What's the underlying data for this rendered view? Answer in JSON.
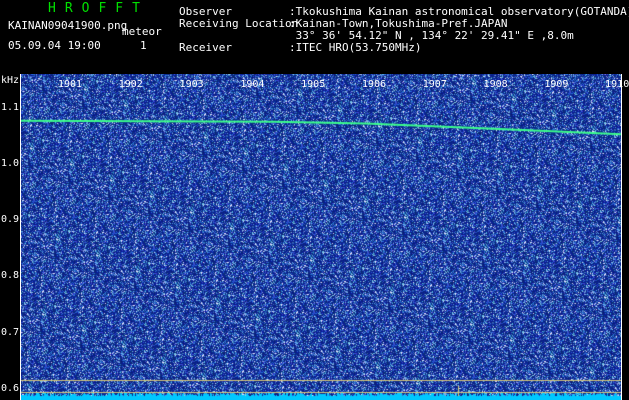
{
  "header": {
    "title": "HROFFT",
    "filename": "KAINAN09041900.png",
    "meteor_label": "meteor",
    "datetime": "05.09.04 19:00",
    "meteor_count": "1",
    "observer_label": "Observer",
    "observer_value": ":Tkokushima Kainan astronomical observatory(GOTANDA)",
    "location_label": "Receiving Location",
    "location_value": ":Kainan-Town,Tokushima-Pref.JAPAN",
    "coords_value": " 33° 36' 54.12\" N , 134° 22' 29.41\" E ,8.0m",
    "receiver_label": "Receiver",
    "receiver_value": ":ITEC HRO(53.750MHz)"
  },
  "colors": {
    "title": "#00e000",
    "header_text": "#ffffff",
    "background": "#000000",
    "noise_base": "#1a2a90",
    "trace": "#3cff8c",
    "floor": "#00c8ff",
    "marker": "#d8c878"
  },
  "chart_data": {
    "type": "heatmap",
    "y_unit": "kHz",
    "y_ticks": [
      "1.1",
      "1.0",
      "0.9",
      "0.8",
      "0.7",
      "0.6"
    ],
    "y_range": [
      0.58,
      1.16
    ],
    "x_ticks": [
      "1901",
      "1902",
      "1903",
      "1904",
      "1905",
      "1906",
      "1907",
      "1908",
      "1909",
      "1910"
    ],
    "trace": {
      "x": [
        "1900",
        "1904.5",
        "1906",
        "1908",
        "1910.2"
      ],
      "y": [
        1.077,
        1.075,
        1.072,
        1.063,
        1.053
      ]
    },
    "horizontal_lines_khz": [
      0.615,
      0.594
    ]
  }
}
